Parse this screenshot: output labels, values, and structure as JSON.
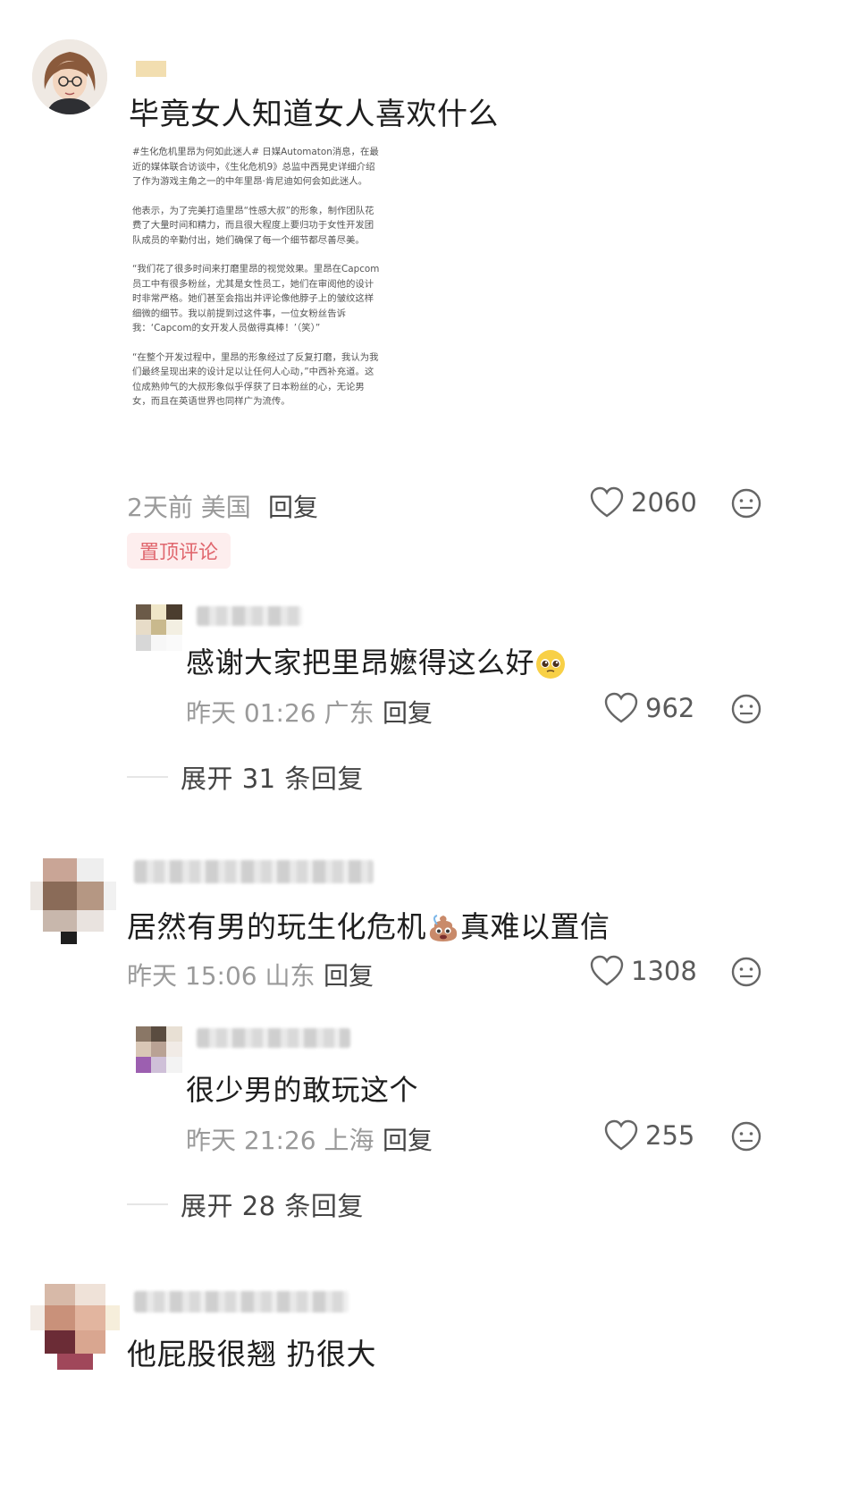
{
  "comments": [
    {
      "text": "毕竟女人知道女人喜欢什么",
      "article": [
        "#生化危机里昂为何如此迷人# 日媒Automaton消息，在最近的媒体联合访谈中，《生化危机9》总监中西晃史详细介绍了作为游戏主角之一的中年里昂·肯尼迪如何会如此迷人。",
        "他表示，为了完美打造里昂“性感大叔”的形象，制作团队花费了大量时间和精力，而且很大程度上要归功于女性开发团队成员的辛勤付出，她们确保了每一个细节都尽善尽美。",
        "“我们花了很多时间来打磨里昂的视觉效果。里昂在Capcom员工中有很多粉丝，尤其是女性员工，她们在审阅他的设计时非常严格。她们甚至会指出并评论像他脖子上的皱纹这样细微的细节。我以前提到过这件事，一位女粉丝告诉我：‘Capcom的女开发人员做得真棒！’（笑）”",
        "“在整个开发过程中，里昂的形象经过了反复打磨，我认为我们最终呈现出来的设计足以让任何人心动，”中西补充道。这位成熟帅气的大叔形象似乎俘获了日本粉丝的心，无论男女，而且在英语世界也同样广为流传。"
      ],
      "time": "2天前 美国",
      "reply": "回复",
      "likes": "2060",
      "pinned": "置顶评论",
      "replies": [
        {
          "text": "感谢大家把里昂嬷得这么好",
          "time": "昨天 01:26 广东",
          "reply": "回复",
          "likes": "962"
        }
      ],
      "expand": "展开 31 条回复"
    },
    {
      "text_a": "居然有男的玩生化危机",
      "text_b": "真难以置信",
      "time": "昨天 15:06 山东",
      "reply": "回复",
      "likes": "1308",
      "replies": [
        {
          "text": "很少男的敢玩这个",
          "time": "昨天 21:26 上海",
          "reply": "回复",
          "likes": "255"
        }
      ],
      "expand": "展开 28 条回复"
    },
    {
      "text": "他屁股很翘 扔很大"
    }
  ],
  "icons": {
    "like": "heart-outline-icon",
    "more": "neutral-face-icon",
    "emoji_1": "pleading-face-emoji",
    "emoji_2": "poop-emoji"
  },
  "colors": {
    "pinned_text": "#e0676e",
    "pinned_bg": "#fdeeee",
    "meta": "#9a9a9a"
  }
}
